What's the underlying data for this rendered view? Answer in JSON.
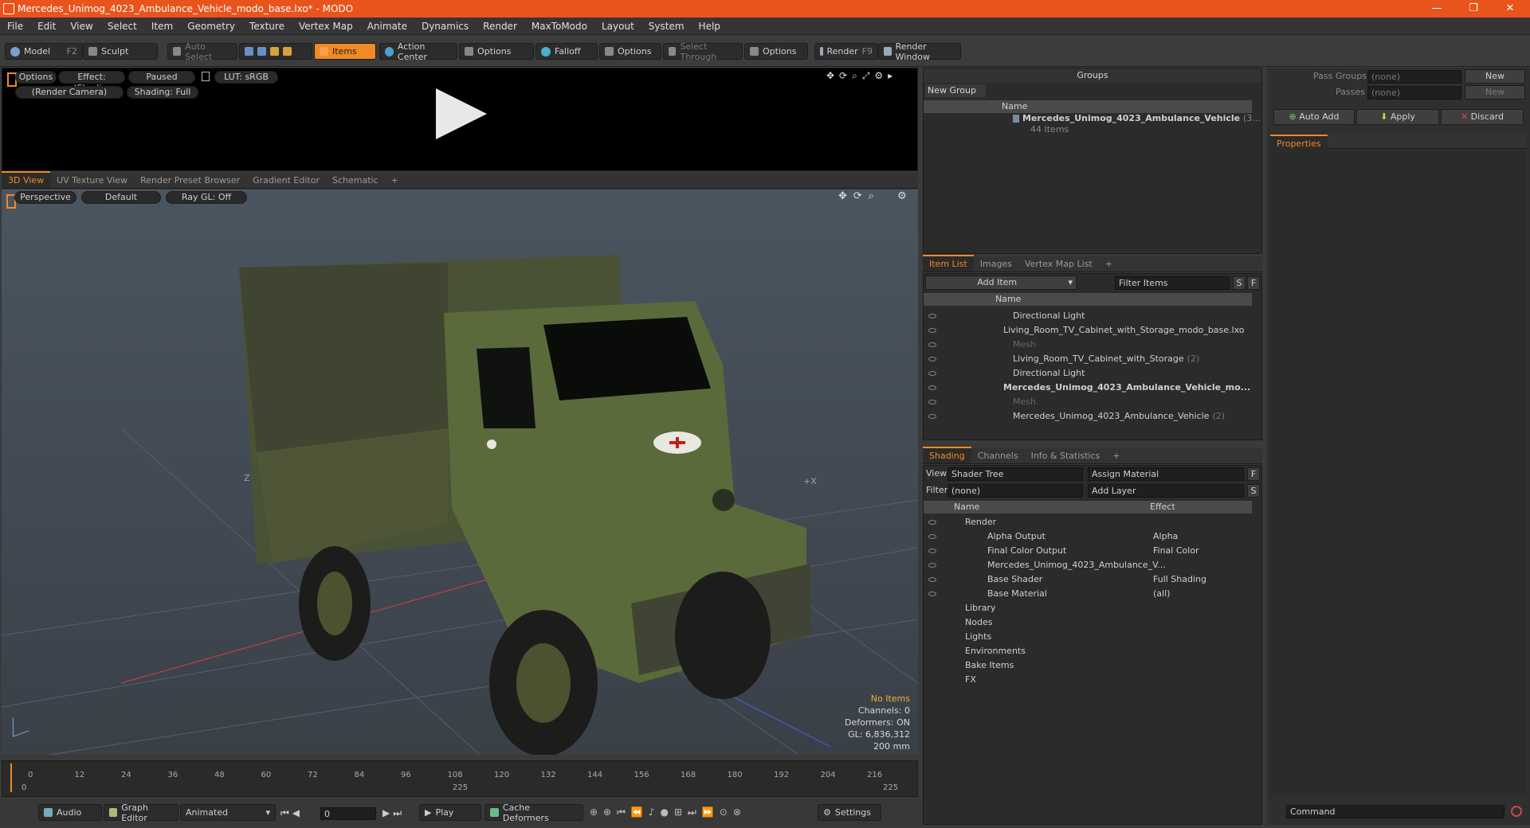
{
  "window": {
    "title": "Mercedes_Unimog_4023_Ambulance_Vehicle_modo_base.lxo* - MODO",
    "minimize": "—",
    "maximize": "❐",
    "close": "✕"
  },
  "menu": [
    "File",
    "Edit",
    "View",
    "Select",
    "Item",
    "Geometry",
    "Texture",
    "Vertex Map",
    "Animate",
    "Dynamics",
    "Render",
    "MaxToModo",
    "Layout",
    "System",
    "Help"
  ],
  "toolbar": {
    "model": "Model",
    "model_key": "F2",
    "sculpt": "Sculpt",
    "auto_select": "Auto Select",
    "items": "Items",
    "action_center": "Action Center",
    "options1": "Options",
    "falloff": "Falloff",
    "options2": "Options",
    "select_through": "Select Through",
    "options3": "Options",
    "render": "Render",
    "render_key": "F9",
    "render_window": "Render Window"
  },
  "preview": {
    "options": "Options",
    "effect": "Effect: (Shadi...",
    "paused": "Paused",
    "lut": "LUT: sRGB",
    "camera": "(Render Camera)",
    "shading": "Shading: Full"
  },
  "viewport_tabs": [
    "3D View",
    "UV Texture View",
    "Render Preset Browser",
    "Gradient Editor",
    "Schematic",
    "+"
  ],
  "viewport": {
    "perspective": "Perspective",
    "default": "Default",
    "raygl": "Ray GL: Off",
    "axis_z": "Z",
    "axis_x": "+X",
    "stats": {
      "no_items": "No Items",
      "channels": "Channels: 0",
      "deformers": "Deformers: ON",
      "gl": "GL: 6,836,312",
      "unit": "200 mm"
    }
  },
  "timeline": {
    "ticks": [
      "0",
      "12",
      "24",
      "36",
      "48",
      "60",
      "72",
      "84",
      "96",
      "108",
      "120",
      "132",
      "144",
      "156",
      "168",
      "180",
      "192",
      "204",
      "216"
    ],
    "start": "0",
    "end": "225",
    "mid": "225"
  },
  "bottombar": {
    "audio": "Audio",
    "graph_editor": "Graph Editor",
    "animated": "Animated",
    "frame": "0",
    "play": "Play",
    "cache": "Cache Deformers",
    "settings": "Settings"
  },
  "groups": {
    "title": "Groups",
    "new_group": "New Group",
    "col_name": "Name",
    "item_name": "Mercedes_Unimog_4023_Ambulance_Vehicle",
    "item_suffix": "(3...",
    "item_count": "44 Items"
  },
  "itemlist": {
    "tabs": [
      "Item List",
      "Images",
      "Vertex Map List",
      "+"
    ],
    "add_item": "Add Item",
    "filter": "Filter Items",
    "s": "S",
    "f": "F",
    "col_name": "Name",
    "rows": [
      {
        "label": "Directional Light",
        "indent": 2,
        "dim": false,
        "bold": false
      },
      {
        "label": "Living_Room_TV_Cabinet_with_Storage_modo_base.lxo",
        "indent": 1,
        "dim": false,
        "bold": false
      },
      {
        "label": "Mesh",
        "indent": 2,
        "dim": true,
        "bold": false
      },
      {
        "label": "Living_Room_TV_Cabinet_with_Storage",
        "suffix": "(2)",
        "indent": 2,
        "dim": false,
        "bold": false
      },
      {
        "label": "Directional Light",
        "indent": 2,
        "dim": false,
        "bold": false
      },
      {
        "label": "Mercedes_Unimog_4023_Ambulance_Vehicle_mo...",
        "indent": 1,
        "dim": false,
        "bold": true
      },
      {
        "label": "Mesh",
        "indent": 2,
        "dim": true,
        "bold": false
      },
      {
        "label": "Mercedes_Unimog_4023_Ambulance_Vehicle",
        "suffix": "(2)",
        "indent": 2,
        "dim": false,
        "bold": false
      }
    ]
  },
  "shading": {
    "tabs": [
      "Shading",
      "Channels",
      "Info & Statistics",
      "+"
    ],
    "view_label": "View",
    "view_value": "Shader Tree",
    "assign": "Assign Material",
    "f": "F",
    "filter_label": "Filter",
    "filter_value": "(none)",
    "add_layer": "Add Layer",
    "s": "S",
    "col_name": "Name",
    "col_effect": "Effect",
    "rows": [
      {
        "label": "Render",
        "effect": "",
        "indent": 0
      },
      {
        "label": "Alpha Output",
        "effect": "Alpha",
        "indent": 1
      },
      {
        "label": "Final Color Output",
        "effect": "Final Color",
        "indent": 1
      },
      {
        "label": "Mercedes_Unimog_4023_Ambulance_V...",
        "effect": "",
        "indent": 1
      },
      {
        "label": "Base Shader",
        "effect": "Full Shading",
        "indent": 1
      },
      {
        "label": "Base Material",
        "effect": "(all)",
        "indent": 1
      },
      {
        "label": "Library",
        "effect": "",
        "indent": 0
      },
      {
        "label": "Nodes",
        "effect": "",
        "indent": 0
      },
      {
        "label": "Lights",
        "effect": "",
        "indent": 0
      },
      {
        "label": "Environments",
        "effect": "",
        "indent": 0
      },
      {
        "label": "Bake Items",
        "effect": "",
        "indent": 0
      },
      {
        "label": "FX",
        "effect": "",
        "indent": 0
      }
    ]
  },
  "right": {
    "pass_groups": "Pass Groups",
    "passes": "Passes",
    "none": "(none)",
    "new": "New",
    "auto_add": "Auto Add",
    "apply": "Apply",
    "discard": "Discard",
    "properties": "Properties",
    "command": "Command"
  }
}
